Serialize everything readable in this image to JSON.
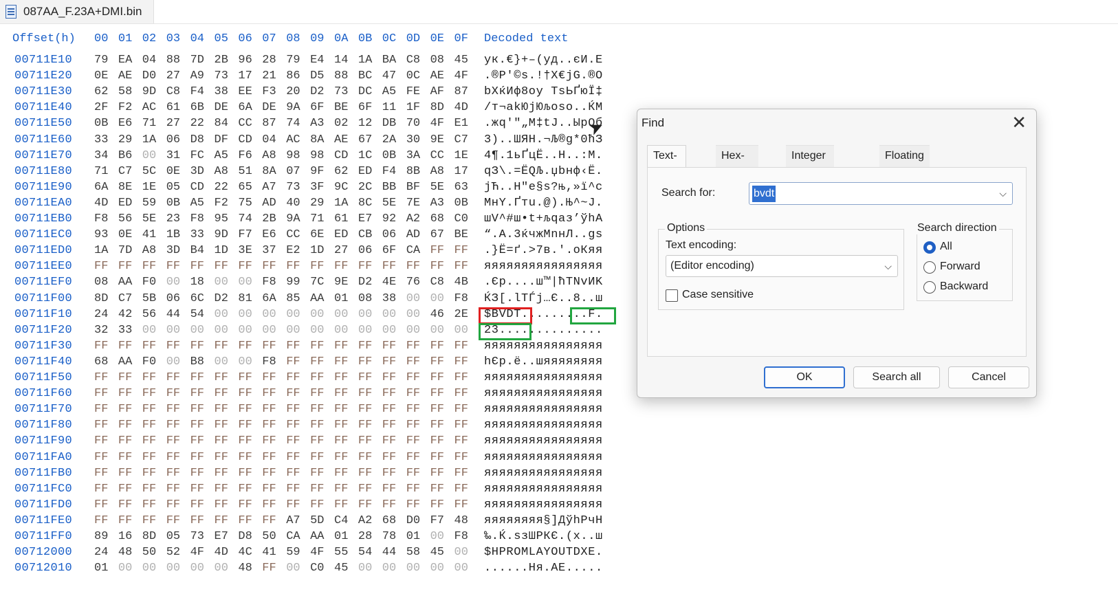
{
  "file_tab": {
    "title": "087AA_F.23A+DMI.bin",
    "icon": "binary-file-icon"
  },
  "hex_header": {
    "offset_label": "Offset(h)",
    "columns": [
      "00",
      "01",
      "02",
      "03",
      "04",
      "05",
      "06",
      "07",
      "08",
      "09",
      "0A",
      "0B",
      "0C",
      "0D",
      "0E",
      "0F"
    ],
    "decoded_label": "Decoded text"
  },
  "rows": [
    {
      "offset": "00711E10",
      "bytes": [
        "79",
        "EA",
        "04",
        "88",
        "7D",
        "2B",
        "96",
        "28",
        "79",
        "E4",
        "14",
        "1A",
        "BA",
        "C8",
        "08",
        "45"
      ],
      "decoded": "ук.€}+–(уд..єИ.E"
    },
    {
      "offset": "00711E20",
      "bytes": [
        "0E",
        "AE",
        "D0",
        "27",
        "A9",
        "73",
        "17",
        "21",
        "86",
        "D5",
        "88",
        "BC",
        "47",
        "0C",
        "AE",
        "4F"
      ],
      "decoded": ".®Р'©s.!†Х€јG.®O"
    },
    {
      "offset": "00711E30",
      "bytes": [
        "62",
        "58",
        "9D",
        "C8",
        "F4",
        "38",
        "EE",
        "F3",
        "20",
        "D2",
        "73",
        "DC",
        "A5",
        "FE",
        "AF",
        "87"
      ],
      "decoded": "bXќИф8оу ТsЬҐюЇ‡"
    },
    {
      "offset": "00711E40",
      "bytes": [
        "2F",
        "F2",
        "AC",
        "61",
        "6B",
        "DE",
        "6A",
        "DE",
        "9A",
        "6F",
        "BE",
        "6F",
        "11",
        "1F",
        "8D",
        "4D"
      ],
      "decoded": "/т¬akЮjЮљoѕo..ЌM"
    },
    {
      "offset": "00711E50",
      "bytes": [
        "0B",
        "E6",
        "71",
        "27",
        "22",
        "84",
        "CC",
        "87",
        "74",
        "A3",
        "02",
        "12",
        "DB",
        "70",
        "4F",
        "E1"
      ],
      "decoded": ".жq'\"„М‡tЈ..ЫpOб"
    },
    {
      "offset": "00711E60",
      "bytes": [
        "33",
        "29",
        "1A",
        "06",
        "D8",
        "DF",
        "CD",
        "04",
        "AC",
        "8A",
        "AE",
        "67",
        "2A",
        "30",
        "9E",
        "C7"
      ],
      "decoded": "3)..ШЯН.¬Љ®g*0ћЗ"
    },
    {
      "offset": "00711E70",
      "bytes": [
        "34",
        "B6",
        "00",
        "31",
        "FC",
        "A5",
        "F6",
        "A8",
        "98",
        "98",
        "CD",
        "1C",
        "0B",
        "3A",
        "CC",
        "1E"
      ],
      "decoded": "4¶.1ьҐцЁ..Н..:М."
    },
    {
      "offset": "00711E80",
      "bytes": [
        "71",
        "C7",
        "5C",
        "0E",
        "3D",
        "A8",
        "51",
        "8A",
        "07",
        "9F",
        "62",
        "ED",
        "F4",
        "8B",
        "A8",
        "17"
      ],
      "decoded": "qЗ\\.=ЁQЉ.џbнф‹Ё."
    },
    {
      "offset": "00711E90",
      "bytes": [
        "6A",
        "8E",
        "1E",
        "05",
        "CD",
        "22",
        "65",
        "A7",
        "73",
        "3F",
        "9C",
        "2C",
        "BB",
        "BF",
        "5E",
        "63"
      ],
      "decoded": "jЋ..Н\"e§s?њ,»ї^c"
    },
    {
      "offset": "00711EA0",
      "bytes": [
        "4D",
        "ED",
        "59",
        "0B",
        "A5",
        "F2",
        "75",
        "AD",
        "40",
        "29",
        "1A",
        "8C",
        "5E",
        "7E",
        "A3",
        "0B"
      ],
      "decoded": "МнY.Ґтu.@).Њ^~Ј."
    },
    {
      "offset": "00711EB0",
      "bytes": [
        "F8",
        "56",
        "5E",
        "23",
        "F8",
        "95",
        "74",
        "2B",
        "9A",
        "71",
        "61",
        "E7",
        "92",
        "A2",
        "68",
        "C0"
      ],
      "decoded": "шV^#ш•t+љqaз’ўhА"
    },
    {
      "offset": "00711EC0",
      "bytes": [
        "93",
        "0E",
        "41",
        "1B",
        "33",
        "9D",
        "F7",
        "E6",
        "CC",
        "6E",
        "ED",
        "CB",
        "06",
        "AD",
        "67",
        "BE"
      ],
      "decoded": "“.A.3ќчжМnнЛ..gѕ"
    },
    {
      "offset": "00711ED0",
      "bytes": [
        "1A",
        "7D",
        "A8",
        "3D",
        "B4",
        "1D",
        "3E",
        "37",
        "E2",
        "1D",
        "27",
        "06",
        "6F",
        "CA",
        "FF",
        "FF"
      ],
      "decoded": ".}Ё=ґ.>7в.'.oКяя"
    },
    {
      "offset": "00711EE0",
      "bytes": [
        "FF",
        "FF",
        "FF",
        "FF",
        "FF",
        "FF",
        "FF",
        "FF",
        "FF",
        "FF",
        "FF",
        "FF",
        "FF",
        "FF",
        "FF",
        "FF"
      ],
      "decoded": "яяяяяяяяяяяяяяяя"
    },
    {
      "offset": "00711EF0",
      "bytes": [
        "08",
        "AA",
        "F0",
        "00",
        "18",
        "00",
        "00",
        "F8",
        "99",
        "7C",
        "9E",
        "D2",
        "4E",
        "76",
        "C8",
        "4B"
      ],
      "decoded": ".Єр....ш™|ћТNvИK"
    },
    {
      "offset": "00711F00",
      "bytes": [
        "8D",
        "C7",
        "5B",
        "06",
        "6C",
        "D2",
        "81",
        "6A",
        "85",
        "AA",
        "01",
        "08",
        "38",
        "00",
        "00",
        "F8"
      ],
      "decoded": "ЌЗ[.lТЃj…Є..8..ш"
    },
    {
      "offset": "00711F10",
      "bytes": [
        "24",
        "42",
        "56",
        "44",
        "54",
        "00",
        "00",
        "00",
        "00",
        "00",
        "00",
        "00",
        "00",
        "00",
        "46",
        "2E"
      ],
      "decoded": "$BVDT.........F."
    },
    {
      "offset": "00711F20",
      "bytes": [
        "32",
        "33",
        "00",
        "00",
        "00",
        "00",
        "00",
        "00",
        "00",
        "00",
        "00",
        "00",
        "00",
        "00",
        "00",
        "00"
      ],
      "decoded": "23.............."
    },
    {
      "offset": "00711F30",
      "bytes": [
        "FF",
        "FF",
        "FF",
        "FF",
        "FF",
        "FF",
        "FF",
        "FF",
        "FF",
        "FF",
        "FF",
        "FF",
        "FF",
        "FF",
        "FF",
        "FF"
      ],
      "decoded": "яяяяяяяяяяяяяяяя"
    },
    {
      "offset": "00711F40",
      "bytes": [
        "68",
        "AA",
        "F0",
        "00",
        "B8",
        "00",
        "00",
        "F8",
        "FF",
        "FF",
        "FF",
        "FF",
        "FF",
        "FF",
        "FF",
        "FF"
      ],
      "decoded": "hЄр.ё..шяяяяяяяя"
    },
    {
      "offset": "00711F50",
      "bytes": [
        "FF",
        "FF",
        "FF",
        "FF",
        "FF",
        "FF",
        "FF",
        "FF",
        "FF",
        "FF",
        "FF",
        "FF",
        "FF",
        "FF",
        "FF",
        "FF"
      ],
      "decoded": "яяяяяяяяяяяяяяяя"
    },
    {
      "offset": "00711F60",
      "bytes": [
        "FF",
        "FF",
        "FF",
        "FF",
        "FF",
        "FF",
        "FF",
        "FF",
        "FF",
        "FF",
        "FF",
        "FF",
        "FF",
        "FF",
        "FF",
        "FF"
      ],
      "decoded": "яяяяяяяяяяяяяяяя"
    },
    {
      "offset": "00711F70",
      "bytes": [
        "FF",
        "FF",
        "FF",
        "FF",
        "FF",
        "FF",
        "FF",
        "FF",
        "FF",
        "FF",
        "FF",
        "FF",
        "FF",
        "FF",
        "FF",
        "FF"
      ],
      "decoded": "яяяяяяяяяяяяяяяя"
    },
    {
      "offset": "00711F80",
      "bytes": [
        "FF",
        "FF",
        "FF",
        "FF",
        "FF",
        "FF",
        "FF",
        "FF",
        "FF",
        "FF",
        "FF",
        "FF",
        "FF",
        "FF",
        "FF",
        "FF"
      ],
      "decoded": "яяяяяяяяяяяяяяяя"
    },
    {
      "offset": "00711F90",
      "bytes": [
        "FF",
        "FF",
        "FF",
        "FF",
        "FF",
        "FF",
        "FF",
        "FF",
        "FF",
        "FF",
        "FF",
        "FF",
        "FF",
        "FF",
        "FF",
        "FF"
      ],
      "decoded": "яяяяяяяяяяяяяяяя"
    },
    {
      "offset": "00711FA0",
      "bytes": [
        "FF",
        "FF",
        "FF",
        "FF",
        "FF",
        "FF",
        "FF",
        "FF",
        "FF",
        "FF",
        "FF",
        "FF",
        "FF",
        "FF",
        "FF",
        "FF"
      ],
      "decoded": "яяяяяяяяяяяяяяяя"
    },
    {
      "offset": "00711FB0",
      "bytes": [
        "FF",
        "FF",
        "FF",
        "FF",
        "FF",
        "FF",
        "FF",
        "FF",
        "FF",
        "FF",
        "FF",
        "FF",
        "FF",
        "FF",
        "FF",
        "FF"
      ],
      "decoded": "яяяяяяяяяяяяяяяя"
    },
    {
      "offset": "00711FC0",
      "bytes": [
        "FF",
        "FF",
        "FF",
        "FF",
        "FF",
        "FF",
        "FF",
        "FF",
        "FF",
        "FF",
        "FF",
        "FF",
        "FF",
        "FF",
        "FF",
        "FF"
      ],
      "decoded": "яяяяяяяяяяяяяяяя"
    },
    {
      "offset": "00711FD0",
      "bytes": [
        "FF",
        "FF",
        "FF",
        "FF",
        "FF",
        "FF",
        "FF",
        "FF",
        "FF",
        "FF",
        "FF",
        "FF",
        "FF",
        "FF",
        "FF",
        "FF"
      ],
      "decoded": "яяяяяяяяяяяяяяяя"
    },
    {
      "offset": "00711FE0",
      "bytes": [
        "FF",
        "FF",
        "FF",
        "FF",
        "FF",
        "FF",
        "FF",
        "FF",
        "A7",
        "5D",
        "C4",
        "A2",
        "68",
        "D0",
        "F7",
        "48"
      ],
      "decoded": "яяяяяяяя§]ДўhРчH"
    },
    {
      "offset": "00711FF0",
      "bytes": [
        "89",
        "16",
        "8D",
        "05",
        "73",
        "E7",
        "D8",
        "50",
        "CA",
        "AA",
        "01",
        "28",
        "78",
        "01",
        "00",
        "F8"
      ],
      "decoded": "‰.Ќ.sзШPКЄ.(x..ш"
    },
    {
      "offset": "00712000",
      "bytes": [
        "24",
        "48",
        "50",
        "52",
        "4F",
        "4D",
        "4C",
        "41",
        "59",
        "4F",
        "55",
        "54",
        "44",
        "58",
        "45",
        "00"
      ],
      "decoded": "$HPROMLAYOUTDXE."
    },
    {
      "offset": "00712010",
      "bytes": [
        "01",
        "00",
        "00",
        "00",
        "00",
        "00",
        "48",
        "FF",
        "00",
        "C0",
        "45",
        "00",
        "00",
        "00",
        "00",
        "00"
      ],
      "decoded": "......Hя.АE....."
    }
  ],
  "find_dialog": {
    "title": "Find",
    "close_icon": "close-icon",
    "tabs": [
      "Text-string",
      "Hex-values",
      "Integer number",
      "Floating point number"
    ],
    "search_label": "Search for:",
    "search_value": "bvdt",
    "options_label": "Options",
    "encoding_label": "Text encoding:",
    "encoding_value": "(Editor encoding)",
    "case_label": "Case sensitive",
    "case_checked": false,
    "direction_label": "Search direction",
    "directions": [
      "All",
      "Forward",
      "Backward"
    ],
    "direction_selected": "All",
    "ok_label": "OK",
    "search_all_label": "Search all",
    "cancel_label": "Cancel"
  },
  "colors": {
    "offset_blue": "#1a5fc8",
    "highlight_red": "#e02020",
    "highlight_green": "#22a640",
    "selection_blue": "#2f6fd0"
  }
}
